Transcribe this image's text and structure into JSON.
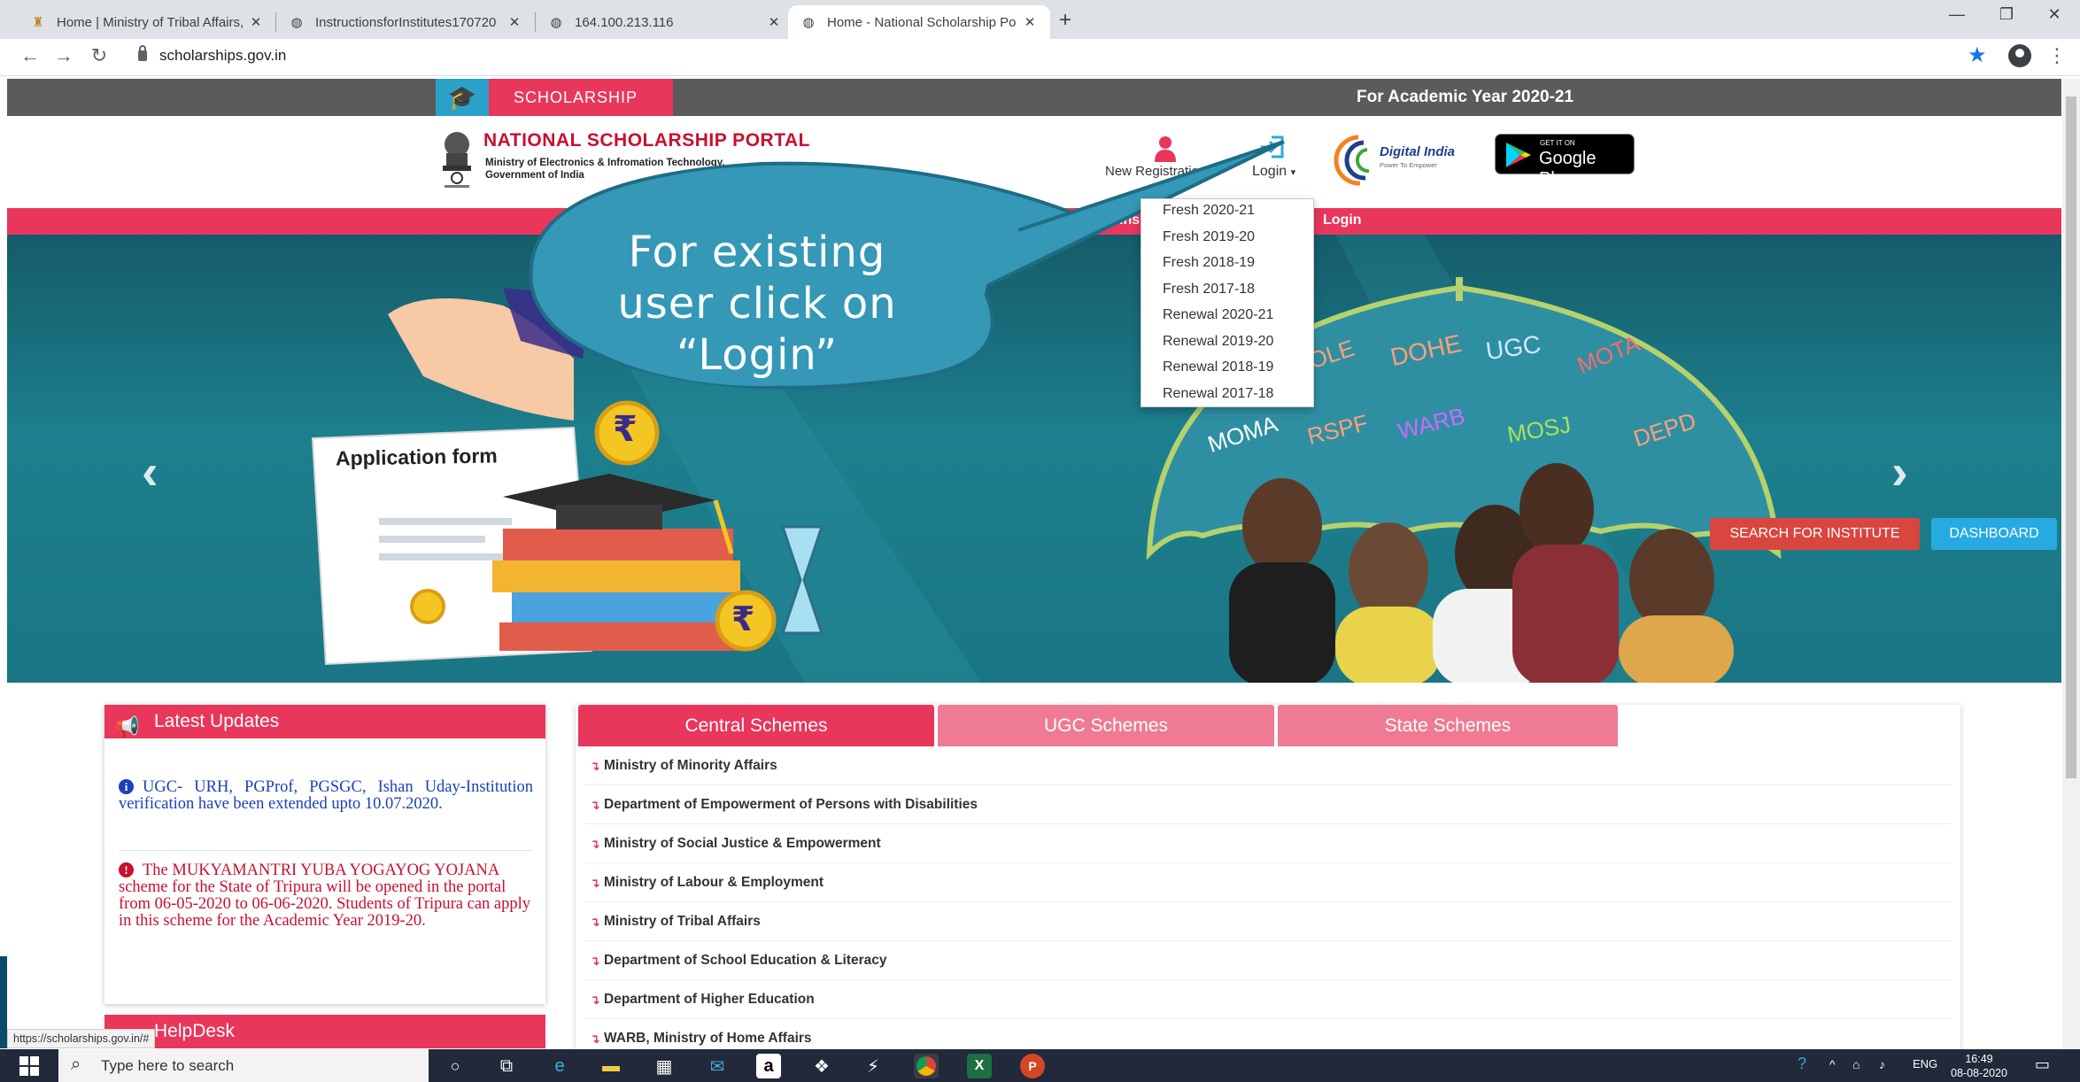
{
  "browser": {
    "tabs": [
      {
        "label": "Home | Ministry of Tribal Affairs,",
        "icon": "emblem-favicon"
      },
      {
        "label": "InstructionsforInstitutes170720",
        "icon": "globe-icon"
      },
      {
        "label": "164.100.213.116",
        "icon": "globe-icon"
      },
      {
        "label": "Home - National Scholarship Po",
        "icon": "globe-icon",
        "active": true
      }
    ],
    "url": "scholarships.gov.in"
  },
  "page": {
    "scholarship_label": "SCHOLARSHIP",
    "academic_year": "For Academic Year 2020-21",
    "portal_title": "NATIONAL SCHOLARSHIP PORTAL",
    "portal_subtitle_1": "Ministry of Electronics & Infromation Technology,",
    "portal_subtitle_2": "Government of India",
    "new_registration": "New Registration",
    "login": "Login",
    "digital_india": "Digital India",
    "digital_india_sub": "Power To Empower",
    "google_play_small": "GET IT ON",
    "google_play_big": "Google Play",
    "nav_institute": "Ins",
    "nav_login": "Login",
    "banner_application": "Application form",
    "umbrella_words": [
      "OLE",
      "DOHE",
      "UGC",
      "MOTA",
      "MOMA",
      "RSPF",
      "WARB",
      "MOSJ",
      "DEPD"
    ],
    "search_for_institute": "SEARCH FOR INSTITUTE",
    "dashboard": "DASHBOARD"
  },
  "login_dropdown": [
    "Fresh 2020-21",
    "Fresh 2019-20",
    "Fresh 2018-19",
    "Fresh 2017-18",
    "Renewal 2020-21",
    "Renewal 2019-20",
    "Renewal 2018-19",
    "Renewal 2017-18"
  ],
  "callout": {
    "line1": "For existing",
    "line2": "user click on",
    "line3": "“Login”"
  },
  "latest_updates": {
    "title": "Latest Updates",
    "item1": "UGC- URH, PGProf, PGSGC, Ishan Uday-Institution verification have been extended upto 10.07.2020.",
    "item2": "The MUKYAMANTRI YUBA YOGAYOG YOJANA scheme for the State of Tripura will be opened in the portal from 06-05-2020 to 06-06-2020. Students of Tripura can apply in this scheme for the Academic Year 2019-20."
  },
  "helpdesk_title": "HelpDesk",
  "status_url": "https://scholarships.gov.in/#",
  "scheme_tabs": [
    "Central Schemes",
    "UGC Schemes",
    "State Schemes"
  ],
  "schemes": [
    "Ministry of Minority Affairs",
    "Department of Empowerment of Persons with Disabilities",
    "Ministry of Social Justice & Empowerment",
    "Ministry of Labour & Employment",
    "Ministry of Tribal Affairs",
    "Department of School Education & Literacy",
    "Department of Higher Education",
    "WARB, Ministry of Home Affairs"
  ],
  "taskbar": {
    "search_placeholder": "Type here to search",
    "lang": "ENG",
    "time": "16:49",
    "date": "08-08-2020"
  },
  "colors": {
    "accent_pink": "#e9365b",
    "teal": "#1d7f8d",
    "callout": "#3498b6"
  }
}
